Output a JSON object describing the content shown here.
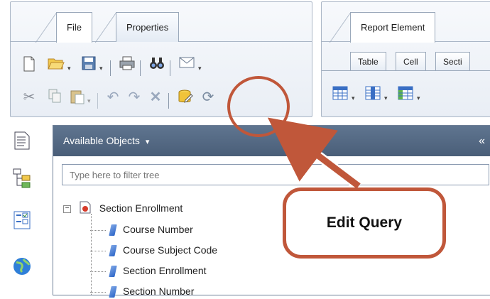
{
  "ribbon_left": {
    "tabs": [
      {
        "label": "File",
        "active": true
      },
      {
        "label": "Properties",
        "active": false
      }
    ],
    "row1_icons": [
      "new-document-icon",
      "open-folder-icon",
      "save-icon",
      "print-icon",
      "find-icon",
      "email-icon"
    ],
    "row2_icons": [
      "cut-icon",
      "copy-icon",
      "paste-icon",
      "undo-icon",
      "redo-icon",
      "delete-icon",
      "edit-query-icon",
      "refresh-icon"
    ]
  },
  "ribbon_right": {
    "tabs": [
      {
        "label": "Report Element",
        "active": true
      }
    ],
    "subtabs": [
      {
        "label": "Table"
      },
      {
        "label": "Cell"
      },
      {
        "label": "Secti"
      }
    ],
    "icons": [
      "table-icon",
      "column-icon",
      "crosstab-icon"
    ]
  },
  "sidebar": {
    "icons": [
      "document-structure-icon",
      "outline-tree-icon",
      "input-controls-icon",
      "web-service-icon"
    ]
  },
  "objects_pane": {
    "title": "Available Objects",
    "title_dropdown": "▾",
    "collapse_label": "«",
    "filter_placeholder": "Type here to filter tree",
    "tree": {
      "root_label": "Section Enrollment",
      "root_expander": "−",
      "items": [
        {
          "label": "Course Number"
        },
        {
          "label": "Course Subject Code"
        },
        {
          "label": "Section Enrollment"
        },
        {
          "label": "Section Number"
        }
      ]
    }
  },
  "annotation": {
    "callout_text": "Edit Query",
    "color": "#c0573a"
  }
}
